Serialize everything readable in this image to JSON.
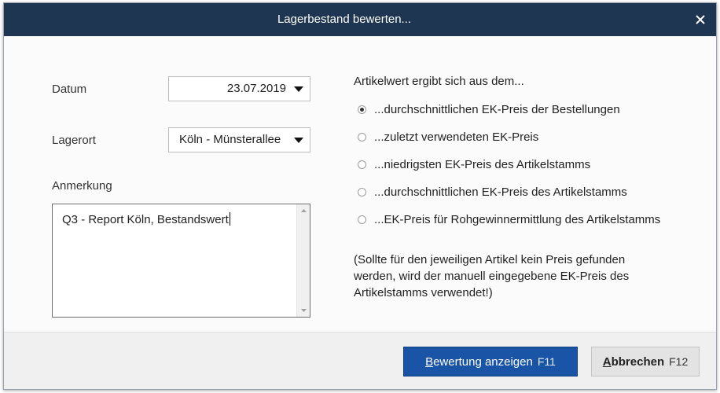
{
  "window": {
    "title": "Lagerbestand bewerten...",
    "close_icon": "close-icon"
  },
  "form": {
    "datum_label": "Datum",
    "datum_value": "23.07.2019",
    "lagerort_label": "Lagerort",
    "lagerort_value": "Köln - Münsterallee",
    "anmerkung_label": "Anmerkung",
    "anmerkung_value": "Q3 - Report Köln, Bestandswert"
  },
  "options": {
    "heading": "Artikelwert ergibt sich aus dem...",
    "items": [
      {
        "label": "...durchschnittlichen EK-Preis der Bestellungen",
        "checked": true
      },
      {
        "label": "...zuletzt verwendeten EK-Preis",
        "checked": false
      },
      {
        "label": "...niedrigsten EK-Preis des Artikelstamms",
        "checked": false
      },
      {
        "label": "...durchschnittlichen EK-Preis des Artikelstamms",
        "checked": false
      },
      {
        "label": "...EK-Preis für Rohgewinnermittlung des Artikelstamms",
        "checked": false
      }
    ],
    "note": "(Sollte für den jeweiligen Artikel kein Preis gefunden werden, wird der manuell eingegebene EK-Preis des Artikelstamms verwendet!)"
  },
  "buttons": {
    "primary_mnemonic": "B",
    "primary_rest": "ewertung anzeigen",
    "primary_key": "F11",
    "cancel_mnemonic": "A",
    "cancel_rest": "bbrechen",
    "cancel_key": "F12"
  },
  "colors": {
    "titlebar": "#1e3651",
    "primary_button": "#1954a6"
  }
}
